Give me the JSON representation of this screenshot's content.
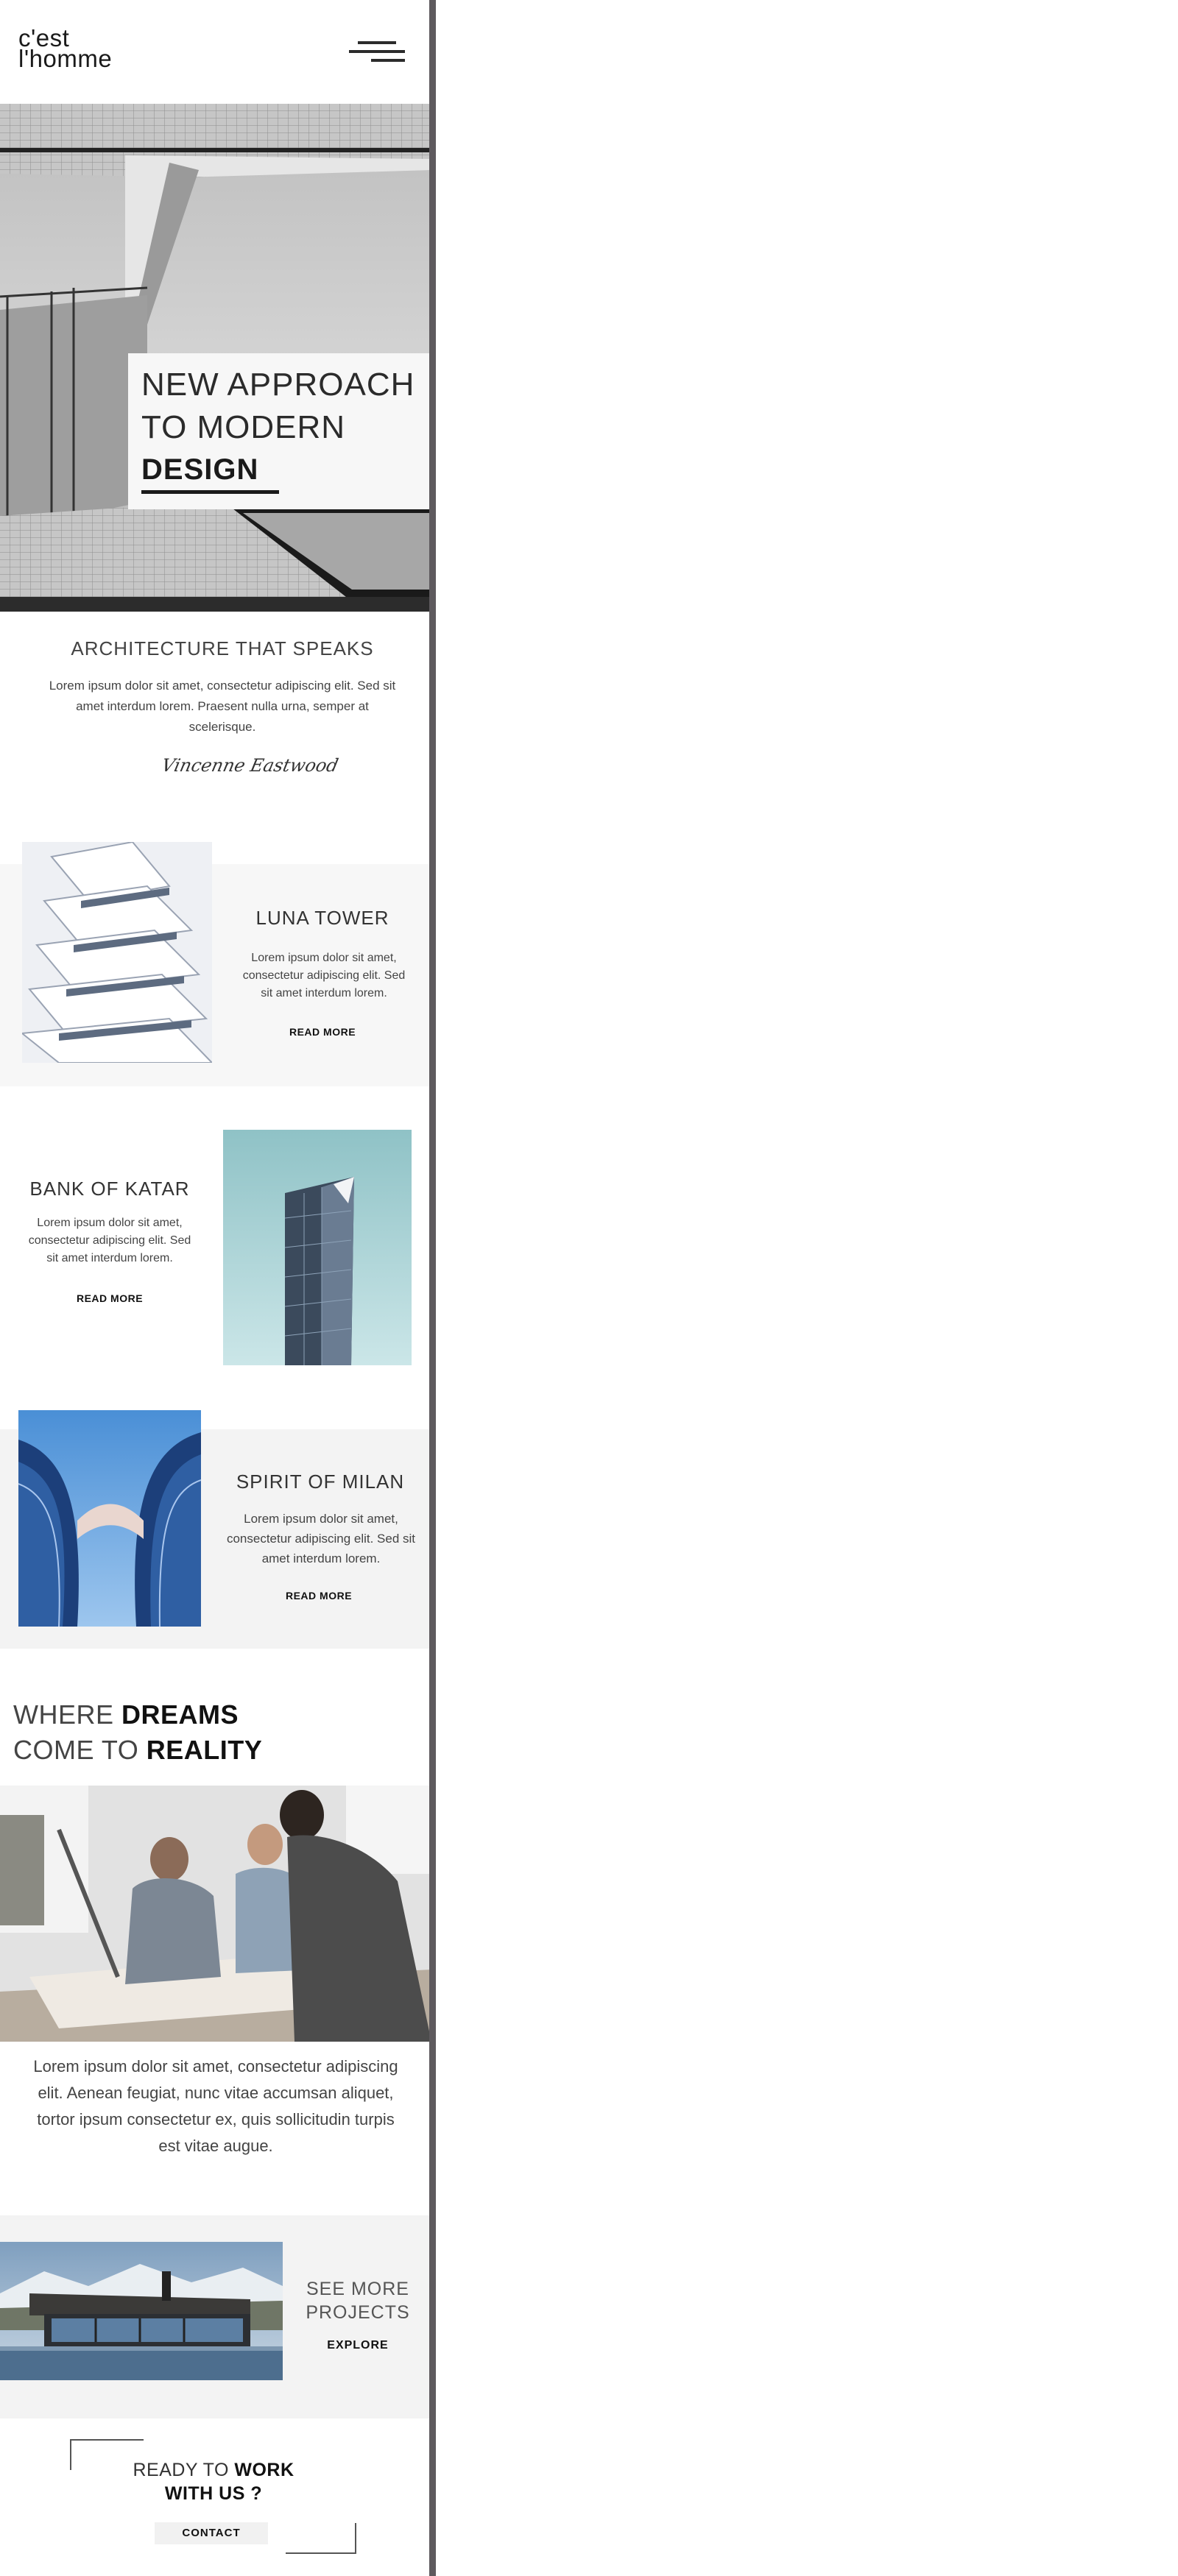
{
  "header": {
    "brand_line1": "c'est",
    "brand_line2": "l'homme",
    "menu_icon": "hamburger-menu-icon"
  },
  "hero": {
    "line1": "NEW APPROACH",
    "line2": "TO MODERN",
    "line3": "DESIGN"
  },
  "intro": {
    "title": "ARCHITECTURE THAT SPEAKS",
    "text": "Lorem ipsum dolor sit amet, consectetur adipiscing elit. Sed sit amet interdum lorem. Praesent nulla urna, semper at scelerisque.",
    "signature": "Vincenne Eastwood"
  },
  "projects": [
    {
      "title": "LUNA TOWER",
      "text": "Lorem ipsum dolor sit amet, consectetur adipiscing elit. Sed sit amet interdum lorem.",
      "link": "READ MORE"
    },
    {
      "title": "BANK OF KATAR",
      "text": "Lorem ipsum dolor sit amet, consectetur adipiscing elit. Sed sit amet interdum lorem.",
      "link": "READ MORE"
    },
    {
      "title": "SPIRIT OF MILAN",
      "text": "Lorem ipsum dolor sit amet, consectetur adipiscing elit. Sed sit amet interdum lorem.",
      "link": "READ MORE"
    }
  ],
  "dreams": {
    "w1": "WHERE",
    "w2": "DREAMS",
    "w3": "COME TO",
    "w4": "REALITY",
    "text": "Lorem ipsum dolor sit amet, consectetur adipiscing elit. Aenean feugiat, nunc vitae accumsan aliquet, tortor ipsum consectetur ex, quis sollicitudin turpis est vitae augue."
  },
  "seemore": {
    "line1": "SEE MORE",
    "line2": "PROJECTS",
    "button": "EXPLORE"
  },
  "cta": {
    "w1": "READY TO",
    "w2": "WORK",
    "w3": "WITH US ?",
    "button": "CONTACT"
  },
  "colors": {
    "divider": "#5e5a5e",
    "panel": "#f7f7f7",
    "text": "#1b1b1b"
  }
}
